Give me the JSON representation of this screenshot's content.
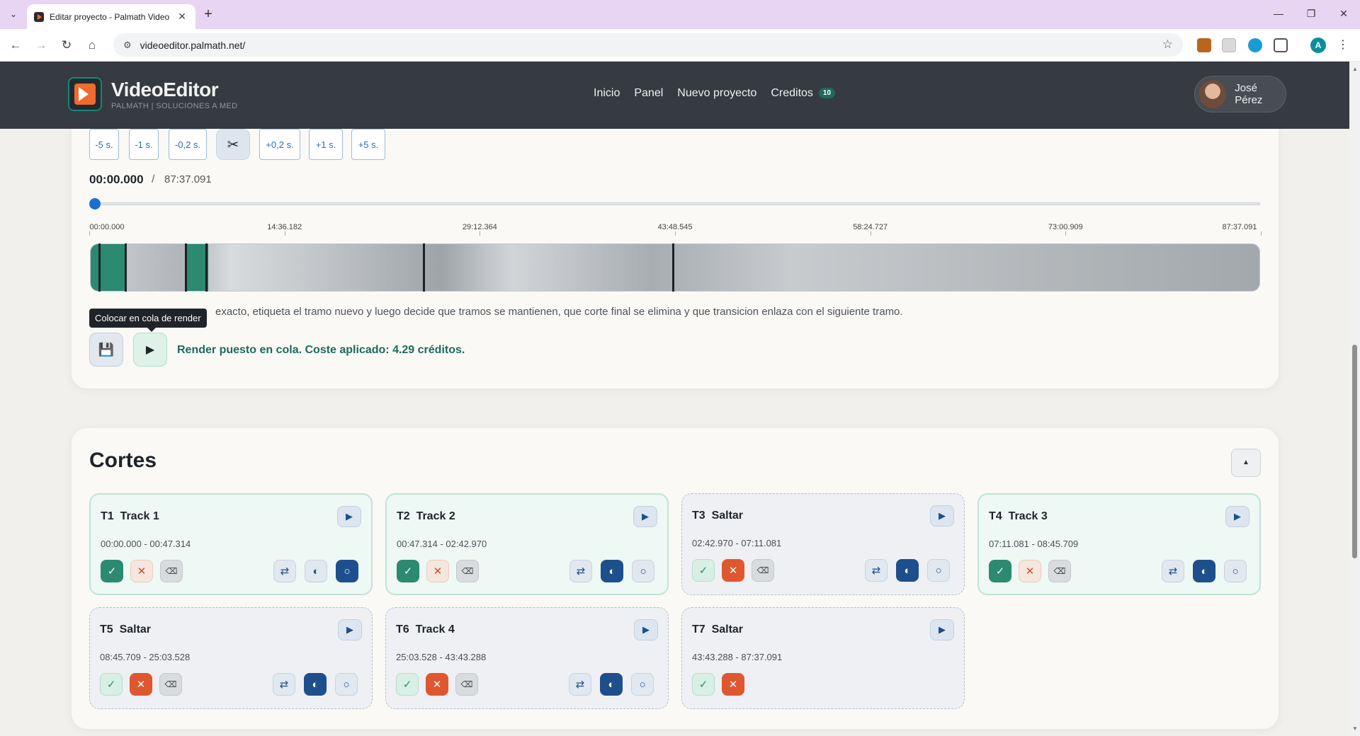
{
  "browser": {
    "tab_title": "Editar proyecto - Palmath Video",
    "url": "videoeditor.palmath.net/",
    "profile_initial": "A"
  },
  "app": {
    "logo_name": "VideoEditor",
    "logo_tagline": "PALMATH | SOLUCIONES A MED",
    "nav": [
      "Inicio",
      "Panel",
      "Nuevo proyecto",
      "Creditos"
    ],
    "credits_count": "10",
    "user_name": "José Pérez"
  },
  "editor": {
    "step_buttons": [
      "-5 s.",
      "-1 s.",
      "-0,2 s.",
      "+0,2 s.",
      "+1 s.",
      "+5 s."
    ],
    "current_time": "00:00.000",
    "separator": "/",
    "total_time": "87:37.091",
    "progress": 0,
    "ticks": [
      "00:00.000",
      "14:36.182",
      "29:12.364",
      "43:48.545",
      "58:24.727",
      "73:00.909",
      "87:37.091"
    ],
    "hint": "exacto, etiqueta el tramo nuevo y luego decide que tramos se mantienen, que corte final se elimina y que transicion enlaza con el siguiente tramo.",
    "tooltip": "Colocar en cola de render",
    "render_message": "Render puesto en cola. Coste aplicado: 4.29 créditos."
  },
  "cortes": {
    "title": "Cortes",
    "tracks": [
      {
        "id": "T1",
        "name": "Track 1",
        "range": "00:00.000 - 00:47.314",
        "keep": true
      },
      {
        "id": "T2",
        "name": "Track 2",
        "range": "00:47.314 - 02:42.970",
        "keep": true
      },
      {
        "id": "T3",
        "name": "Saltar",
        "range": "02:42.970 - 07:11.081",
        "keep": false
      },
      {
        "id": "T4",
        "name": "Track 3",
        "range": "07:11.081 - 08:45.709",
        "keep": true
      },
      {
        "id": "T5",
        "name": "Saltar",
        "range": "08:45.709 - 25:03.528",
        "keep": false
      },
      {
        "id": "T6",
        "name": "Track 4",
        "range": "25:03.528 - 43:43.288",
        "keep": false
      },
      {
        "id": "T7",
        "name": "Saltar",
        "range": "43:43.288 - 87:37.091",
        "keep": false
      }
    ]
  },
  "colors": {
    "accent_green": "#2b8a70",
    "accent_red": "#e0562f",
    "accent_blue": "#1d4f8c",
    "header_bg": "#353b40"
  }
}
